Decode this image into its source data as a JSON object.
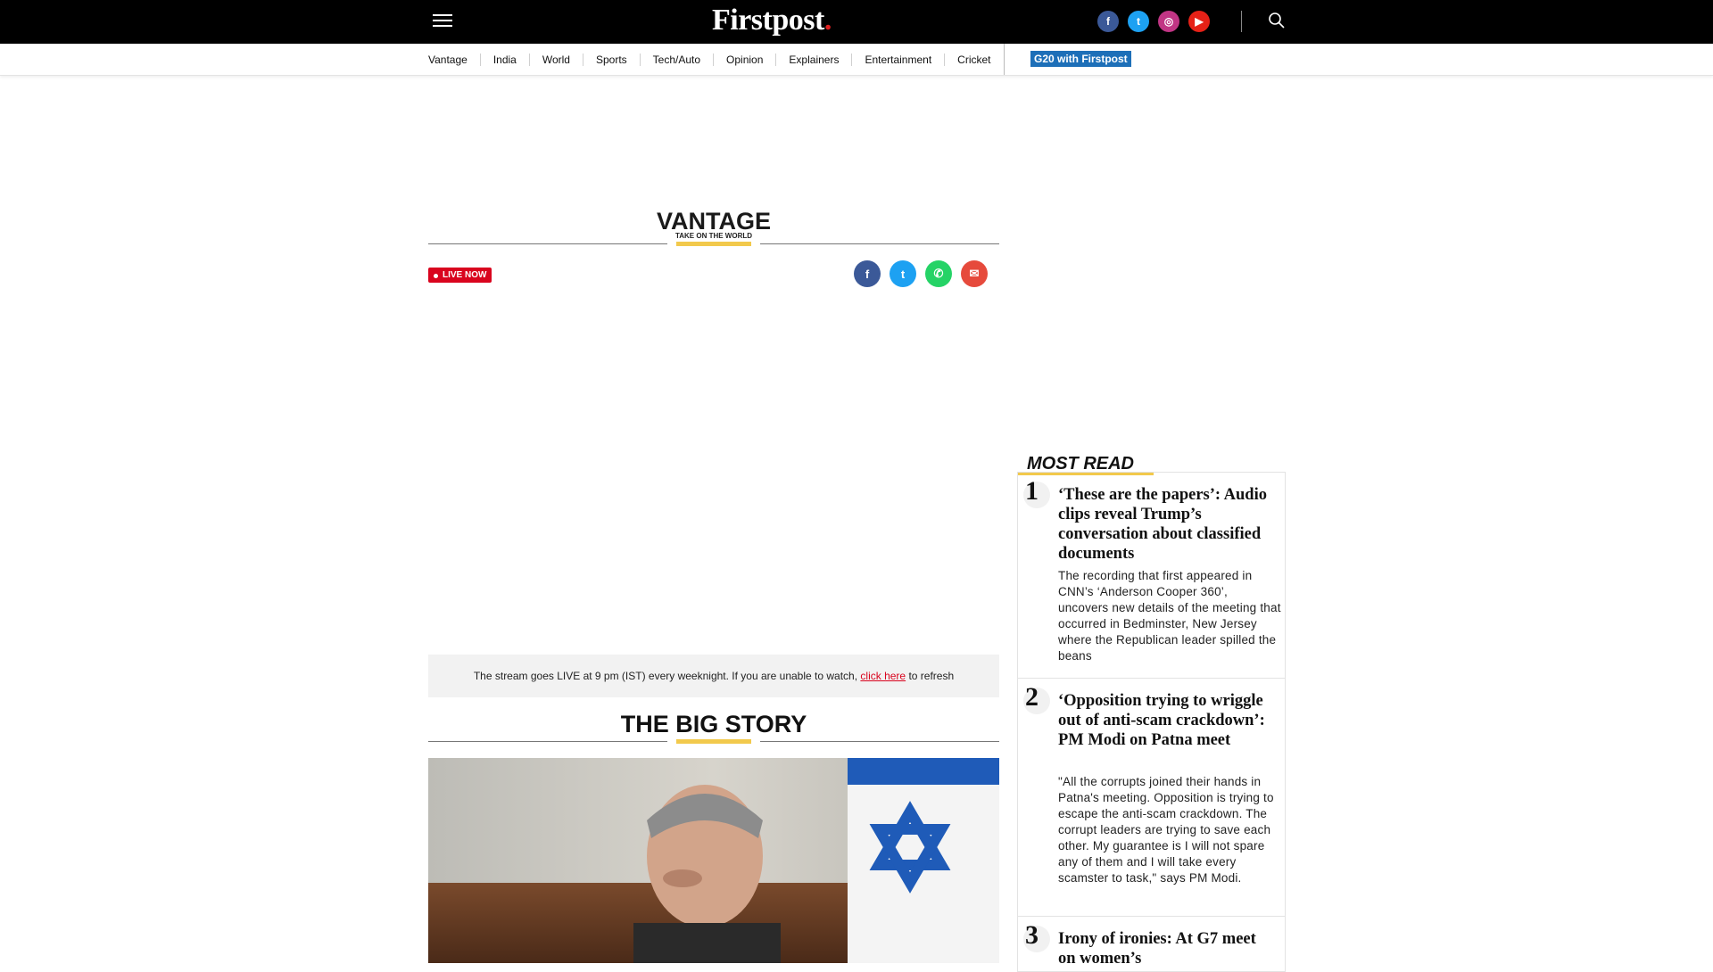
{
  "header": {
    "logo_text": "Firstpost",
    "logo_dot": ".",
    "social": [
      {
        "icon": "facebook-icon",
        "glyph": "f",
        "color": "#3b5998"
      },
      {
        "icon": "twitter-icon",
        "glyph": "t",
        "color": "#1da1f2"
      },
      {
        "icon": "instagram-icon",
        "glyph": "◎",
        "color": "#c13584"
      },
      {
        "icon": "youtube-icon",
        "glyph": "▶",
        "color": "#e62117"
      }
    ]
  },
  "nav": {
    "items": [
      "Vantage",
      "India",
      "World",
      "Sports",
      "Tech/Auto",
      "Opinion",
      "Explainers",
      "Entertainment",
      "Cricket"
    ],
    "g20_label": "G20 with Firstpost"
  },
  "vantage": {
    "brand": "VANTAGE",
    "tagline": "TAKE ON THE WORLD",
    "live_label": "LIVE NOW",
    "share": [
      {
        "icon": "facebook-share-icon",
        "glyph": "f",
        "color": "#3b5998"
      },
      {
        "icon": "twitter-share-icon",
        "glyph": "t",
        "color": "#1da1f2"
      },
      {
        "icon": "whatsapp-share-icon",
        "glyph": "✆",
        "color": "#25d366"
      },
      {
        "icon": "email-share-icon",
        "glyph": "✉",
        "color": "#e64a3c"
      }
    ],
    "stream_text": "The stream goes LIVE at 9 pm (IST) every weeknight. If you are unable to watch,",
    "stream_link": "click here",
    "stream_suffix": "to refresh"
  },
  "big_story": {
    "title": "THE BIG STORY"
  },
  "most_read": {
    "title": "MOST READ",
    "items": [
      {
        "num": "1",
        "headline": "‘These are the papers’: Audio clips reveal Trump’s conversation about classified documents",
        "desc": "The recording that first appeared in CNN’s ‘Anderson Cooper 360’, uncovers new details of the meeting that occurred in Bedminster, New Jersey where the Republican leader spilled the beans"
      },
      {
        "num": "2",
        "headline": "‘Opposition trying to wriggle out of anti-scam crackdown’: PM Modi on Patna meet",
        "desc": "\"All the corrupts joined their hands in Patna's meeting. Opposition is trying to escape the anti-scam crackdown. The corrupt leaders are trying to save each other. My guarantee is I will not spare any of them and I will take every scamster to task,\" says PM Modi."
      },
      {
        "num": "3",
        "headline": "Irony of ironies: At G7 meet on women’s",
        "desc": ""
      }
    ]
  }
}
